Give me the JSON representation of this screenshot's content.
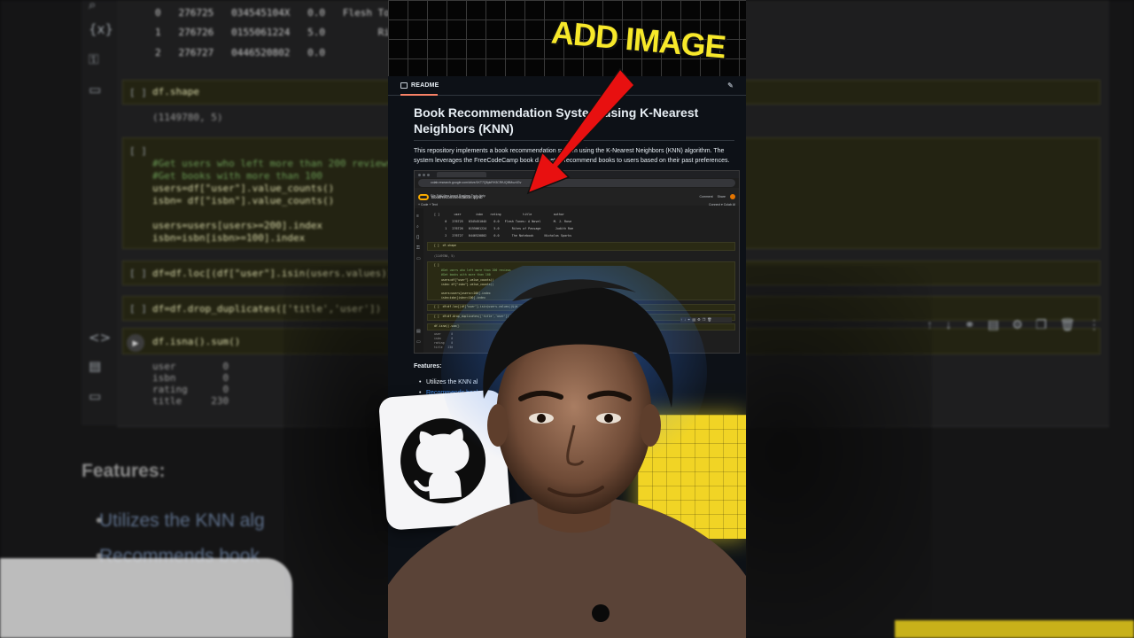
{
  "background": {
    "sidebar_icons": [
      "⌕",
      "{x}",
      "⚿",
      "▭",
      "<>",
      "▤",
      "▭"
    ],
    "table_rows": [
      "0   276725   034545104X   0.0   Flesh Tones: A N",
      "1   276726   0155061224   5.0         Rites of Pass",
      "2   276727   0446520802   0.0            The Notebo"
    ],
    "cells": [
      {
        "bracket": "[ ]",
        "code": "df.shape",
        "output": "(1149780, 5)"
      },
      {
        "bracket": "[ ]",
        "comment1": "#Get users who left more than 200 reviews",
        "comment2": "#Get books with more than 100",
        "code": "users=df[\"user\"].value_counts()\nisbn= df[\"isbn\"].value_counts()\n\nusers=users[users>=200].index\nisbn=isbn[isbn>=100].index"
      },
      {
        "bracket": "[ ]",
        "code": "df=df.loc[(df[\"user\"].isin(users.values))&(df"
      },
      {
        "bracket": "[ ]",
        "code": "df=df.drop_duplicates(['title','user'])"
      },
      {
        "code": "df.isna().sum()",
        "output": "user        0\nisbn        0\nrating      0\ntitle     230"
      }
    ],
    "features_heading": "Features:",
    "features_items": [
      "Utilizes the KNN alg",
      "Recommends book"
    ],
    "cell_tools": [
      "↑",
      "↓",
      "⚭",
      "▤",
      "⚙",
      "❐",
      "🗑",
      "⋮"
    ]
  },
  "overlay": {
    "add_image_label": "ADD IMAGE",
    "arrow_color": "#e81010",
    "yellow": "#f1d425"
  },
  "readme": {
    "tab_label": "README",
    "title": "Book Recommendation System using K-Nearest Neighbors (KNN)",
    "description": "This repository implements a book recommendation system using the K-Nearest Neighbors (KNN) algorithm. The system leverages the FreeCodeCamp book dataset to recommend books to users based on their past preferences.",
    "features_heading": "Features:",
    "features_items": [
      "Utilizes the KNN al",
      "Recommends book"
    ],
    "embedded": {
      "url": "colab.research.google.com/drive/1KT7Q5pkRH3CRfUQ9lMuz4Gv",
      "notebook_name": "BookRecommendation.ipynb",
      "header_buttons": [
        "Comment",
        "Share"
      ],
      "menu": "File   Edit   View   Insert   Runtime   Tools   Help",
      "toolbar_left": "+ Code   + Text",
      "toolbar_right": "Connect ▾       Colab AI",
      "table": "[ ]        user        isbn    rating            title            author\n      0   276725   034545104X    0.0   Flesh Tones: A Novel       M. J. Rose\n      1   276726   0155061224    5.0       Rites of Passage        Judith Rae\n      2   276727   0446520802    0.0       The Notebook      Nicholas Sparks",
      "cell_shape": "[ ]  df.shape",
      "cell_shape_out": "(1149780, 5)",
      "cell_users_comment": "#Get users who left more than 200 reviews\n#Get books with more than 100",
      "cell_users_code": "users=df[\"user\"].value_counts()\nisbn= df[\"isbn\"].value_counts()\n\nusers=users[users>=200].index\nisbn=isbn[isbn>=100].index",
      "cell_loc": "[ ]  df=df.loc[(df[\"user\"].isin(users.values))&(d",
      "cell_dedup": "[ ]  df=df.drop_duplicates(['title','user'])",
      "cell_isna": "df.isna().sum()",
      "cell_isna_out": "user      0\nisbn      0\nrating    0\ntitle   230"
    }
  }
}
